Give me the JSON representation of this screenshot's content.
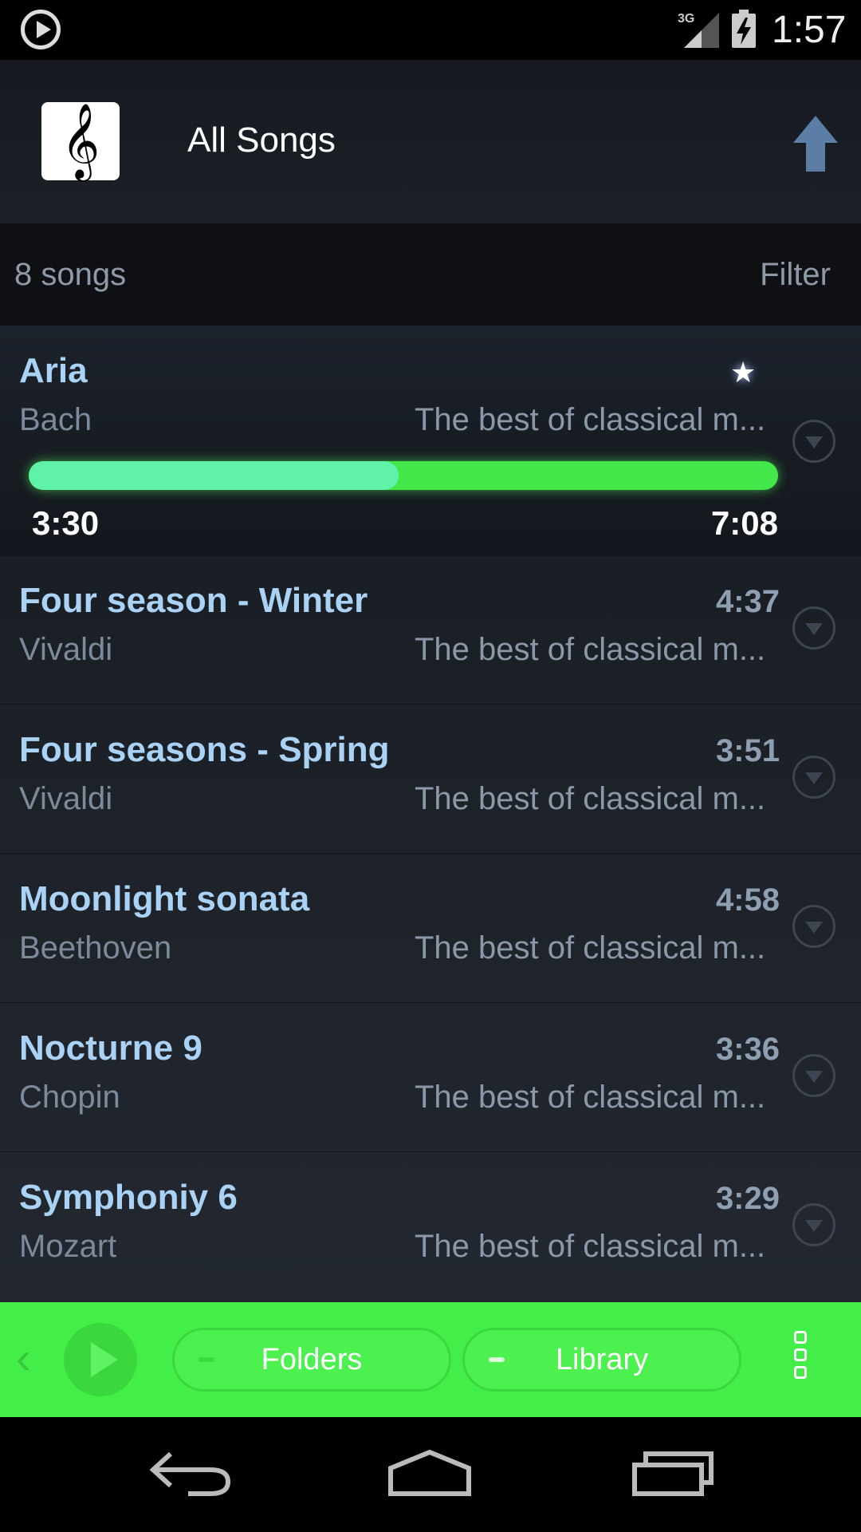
{
  "status": {
    "time": "1:57",
    "network": "3G",
    "icons": [
      "play-notification-icon",
      "signal-icon",
      "battery-charging-icon"
    ]
  },
  "header": {
    "logo_glyph": "𝄞",
    "title": "All Songs",
    "up_icon": "arrow-up-icon"
  },
  "list_header": {
    "count": "8 songs",
    "filter": "Filter"
  },
  "now_playing": {
    "title": "Aria",
    "artist": "Bach",
    "album": "The best of classical m...",
    "favorite_icon": "star-icon",
    "elapsed": "3:30",
    "total": "7:08",
    "progress_fraction": 0.494
  },
  "songs": [
    {
      "title": "Four season - Winter",
      "artist": "Vivaldi",
      "album": "The best of classical m...",
      "duration": "4:37"
    },
    {
      "title": "Four seasons - Spring",
      "artist": "Vivaldi",
      "album": "The best of classical m...",
      "duration": "3:51"
    },
    {
      "title": "Moonlight sonata",
      "artist": "Beethoven",
      "album": "The best of classical m...",
      "duration": "4:58"
    },
    {
      "title": "Nocturne 9",
      "artist": "Chopin",
      "album": "The best of classical m...",
      "duration": "3:36"
    },
    {
      "title": "Symphoniy 6",
      "artist": "Mozart",
      "album": "The best of classical m...",
      "duration": "3:29"
    }
  ],
  "controls": {
    "folders": "Folders",
    "library": "Library",
    "accent": "#44ee48"
  },
  "colors": {
    "title": "#a9d2f5",
    "progress_played": "#5ff2a8",
    "progress_track": "#45e84a"
  }
}
